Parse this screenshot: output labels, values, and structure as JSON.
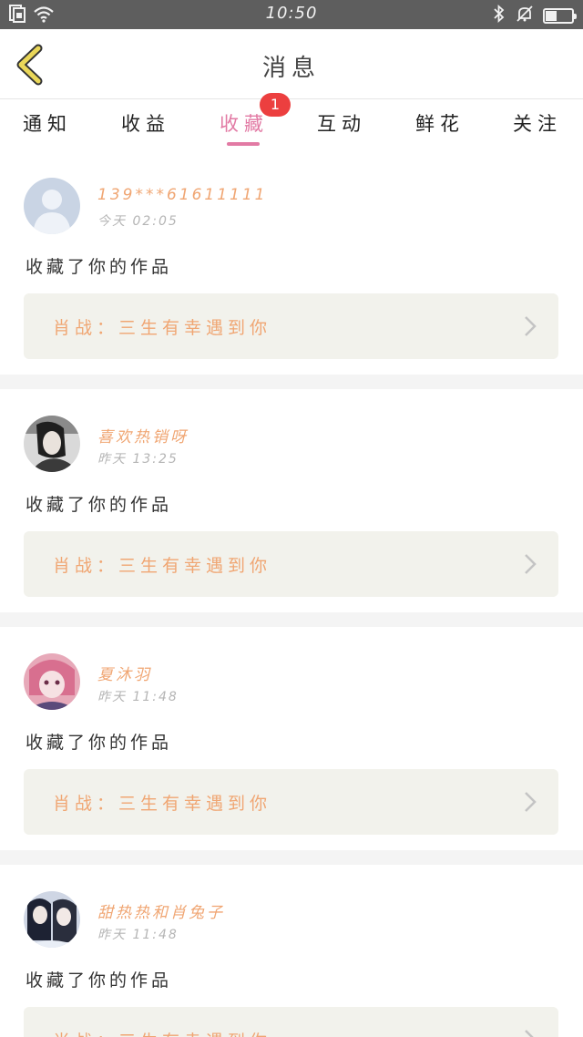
{
  "status_bar": {
    "time": "10:50",
    "icons": [
      "sim-icon",
      "wifi-icon",
      "bluetooth-icon",
      "mute-icon",
      "battery-icon"
    ],
    "battery_level": 0.4
  },
  "header": {
    "title": "消息",
    "back_icon": "chevron-left-icon",
    "accent": "#e6d45a"
  },
  "tabs": [
    {
      "label": "通知",
      "active": false
    },
    {
      "label": "收益",
      "active": false
    },
    {
      "label": "收藏",
      "active": true,
      "badge": "1"
    },
    {
      "label": "互动",
      "active": false
    },
    {
      "label": "鲜花",
      "active": false
    },
    {
      "label": "关注",
      "active": false
    }
  ],
  "colors": {
    "active_tab": "#e27aa4",
    "badge": "#ec3f3f",
    "username": "#f0a673",
    "work_title": "#f0a673",
    "work_box_bg": "#f2f2ec"
  },
  "messages": [
    {
      "username": "139***61611111",
      "time": "今天 02:05",
      "action": "收藏了你的作品",
      "work_title": "肖战：三生有幸遇到你",
      "avatar": "default-avatar-icon"
    },
    {
      "username": "喜欢热销呀",
      "time": "昨天 13:25",
      "action": "收藏了你的作品",
      "work_title": "肖战：三生有幸遇到你",
      "avatar": "photo-avatar"
    },
    {
      "username": "夏沐羽",
      "time": "昨天 11:48",
      "action": "收藏了你的作品",
      "work_title": "肖战：三生有幸遇到你",
      "avatar": "anime-avatar"
    },
    {
      "username": "甜热热和肖兔子",
      "time": "昨天 11:48",
      "action": "收藏了你的作品",
      "work_title": "肖战：三生有幸遇到你",
      "avatar": "couple-avatar"
    }
  ]
}
